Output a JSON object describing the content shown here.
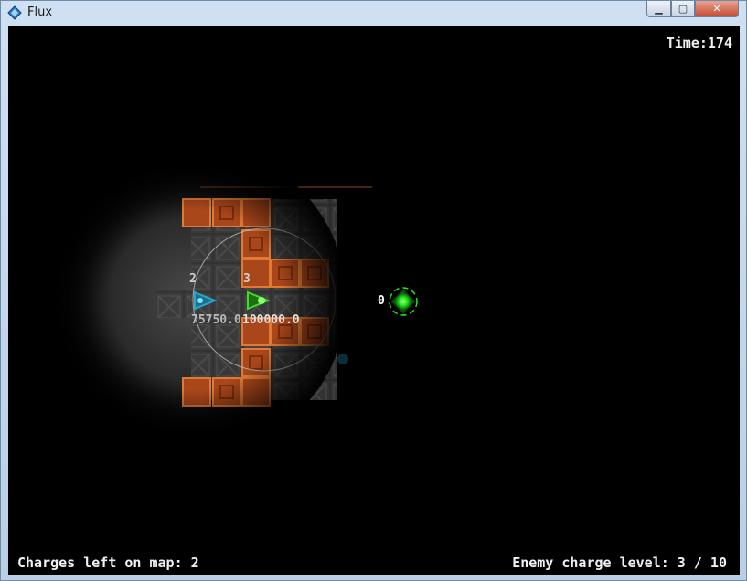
{
  "window": {
    "title": "Flux",
    "minimize_icon": "minimize-icon",
    "maximize_icon": "maximize-icon",
    "close_icon": "close-icon",
    "app_icon": "flux-app-icon"
  },
  "hud": {
    "time": "Time:174",
    "charges_left": "Charges left on map: 2",
    "enemy_charge_level": "Enemy charge level: 3 / 10"
  },
  "units": [
    {
      "id_label": "2",
      "value_label": "75750.0",
      "color": "#2aa7c9"
    },
    {
      "id_label": "3",
      "value_label": "100000.0",
      "color": "#3ddc2a"
    }
  ],
  "target": {
    "label": "0",
    "color": "#22e61e"
  },
  "colors": {
    "tile_orange": "#c9561a",
    "tile_gray": "#5a5a5a",
    "background": "#000000"
  }
}
